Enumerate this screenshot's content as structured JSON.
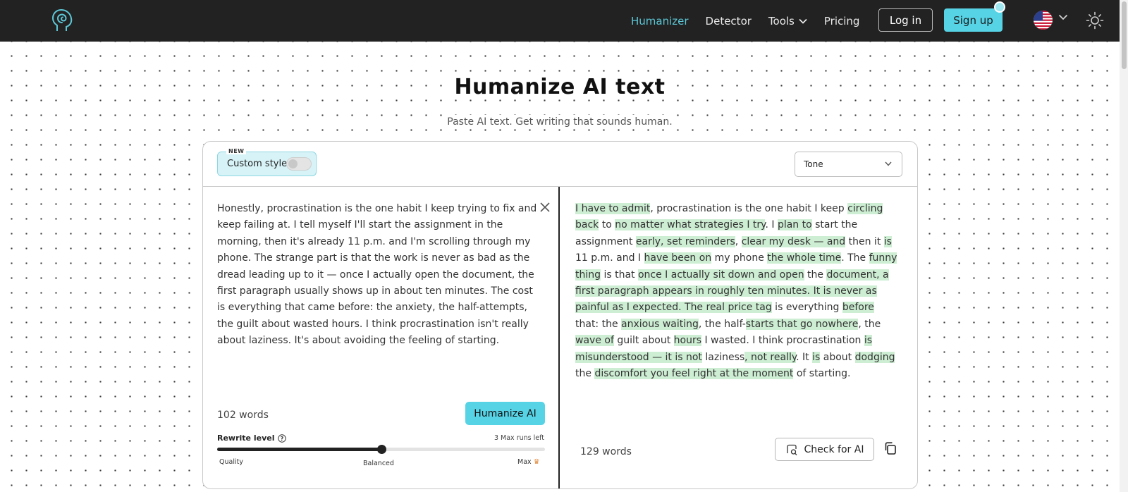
{
  "nav": {
    "items": [
      {
        "label": "Humanizer",
        "active": true
      },
      {
        "label": "Detector",
        "active": false
      },
      {
        "label": "Tools",
        "active": false,
        "has_dropdown": true
      },
      {
        "label": "Pricing",
        "active": false
      }
    ],
    "login_label": "Log in",
    "signup_label": "Sign up",
    "accent_color": "#57d3e6",
    "bar_color": "#222222"
  },
  "hero": {
    "title": "Humanize AI text",
    "subtitle": "Paste AI text. Get writing that sounds human."
  },
  "toolbar": {
    "new_tag": "NEW",
    "custom_style_label": "Custom style",
    "custom_style_enabled": false,
    "tone_label": "Tone"
  },
  "input": {
    "text": "Honestly, procrastination is the one habit I keep trying to fix and keep failing at. I tell myself I'll start the assignment in the morning, then it's already 11 p.m. and I'm scrolling through my phone. The strange part is that the work is never as bad as the dread leading up to it — once I actually open the document, the first paragraph usually shows up in about ten minutes. The cost is everything that came before: the anxiety, the half-attempts, the guilt about wasted hours. I think procrastination isn't really about laziness. It's about avoiding the feeling of starting.",
    "word_count": "102 words",
    "humanize_label": "Humanize AI",
    "rewrite_level_label": "Rewrite level",
    "runs_left": "3 Max runs left",
    "slider_value": 0.5,
    "slider_labels": {
      "min": "Quality",
      "mid": "Balanced",
      "max": "Max"
    }
  },
  "output": {
    "segments": [
      {
        "t": "I have to admit",
        "h": true
      },
      {
        "t": ", procrastination is the one habit I keep ",
        "h": false
      },
      {
        "t": "circling back",
        "h": true
      },
      {
        "t": " to ",
        "h": false
      },
      {
        "t": "no matter what strategies I try",
        "h": true
      },
      {
        "t": ". I ",
        "h": false
      },
      {
        "t": "plan to",
        "h": true
      },
      {
        "t": " start the assignment ",
        "h": false
      },
      {
        "t": "early, set reminders",
        "h": true
      },
      {
        "t": ", ",
        "h": false
      },
      {
        "t": "clear my desk — and",
        "h": true
      },
      {
        "t": " then it ",
        "h": false
      },
      {
        "t": "is",
        "h": true
      },
      {
        "t": " 11 p.m. and I ",
        "h": false
      },
      {
        "t": "have been on",
        "h": true
      },
      {
        "t": " my phone ",
        "h": false
      },
      {
        "t": "the whole time",
        "h": true
      },
      {
        "t": ". The ",
        "h": false
      },
      {
        "t": "funny thing",
        "h": true
      },
      {
        "t": " is that ",
        "h": false
      },
      {
        "t": "once I actually sit down and open",
        "h": true
      },
      {
        "t": " the ",
        "h": false
      },
      {
        "t": "document, a first paragraph appears in roughly ten minutes. It is never as painful as I expected. The real price tag",
        "h": true
      },
      {
        "t": " is everything ",
        "h": false
      },
      {
        "t": "before",
        "h": true
      },
      {
        "t": " that: the ",
        "h": false
      },
      {
        "t": "anxious waiting",
        "h": true
      },
      {
        "t": ", the half-",
        "h": false
      },
      {
        "t": "starts that go nowhere",
        "h": true
      },
      {
        "t": ", the ",
        "h": false
      },
      {
        "t": "wave of",
        "h": true
      },
      {
        "t": " guilt about ",
        "h": false
      },
      {
        "t": "hours",
        "h": true
      },
      {
        "t": " I wasted. I think procrastination ",
        "h": false
      },
      {
        "t": "is misunderstood — it is not",
        "h": true
      },
      {
        "t": " laziness",
        "h": false
      },
      {
        "t": ", not really",
        "h": true
      },
      {
        "t": ". It ",
        "h": false
      },
      {
        "t": "is",
        "h": true
      },
      {
        "t": " about ",
        "h": false
      },
      {
        "t": "dodging",
        "h": true
      },
      {
        "t": " the ",
        "h": false
      },
      {
        "t": "discomfort you feel right at the moment",
        "h": true
      },
      {
        "t": " of starting.",
        "h": false
      }
    ],
    "highlight_color": "#cdeed3",
    "word_count": "129 words",
    "check_label": "Check for AI"
  },
  "icons": {
    "logo": "head-spiral-logo-icon",
    "tools_chevron": "chevron-down-icon",
    "language": "us-flag-icon",
    "theme": "sun-icon",
    "clear": "close-icon",
    "help": "question-circle-icon",
    "check": "magnifier-bubble-icon",
    "copy": "copy-icon"
  }
}
